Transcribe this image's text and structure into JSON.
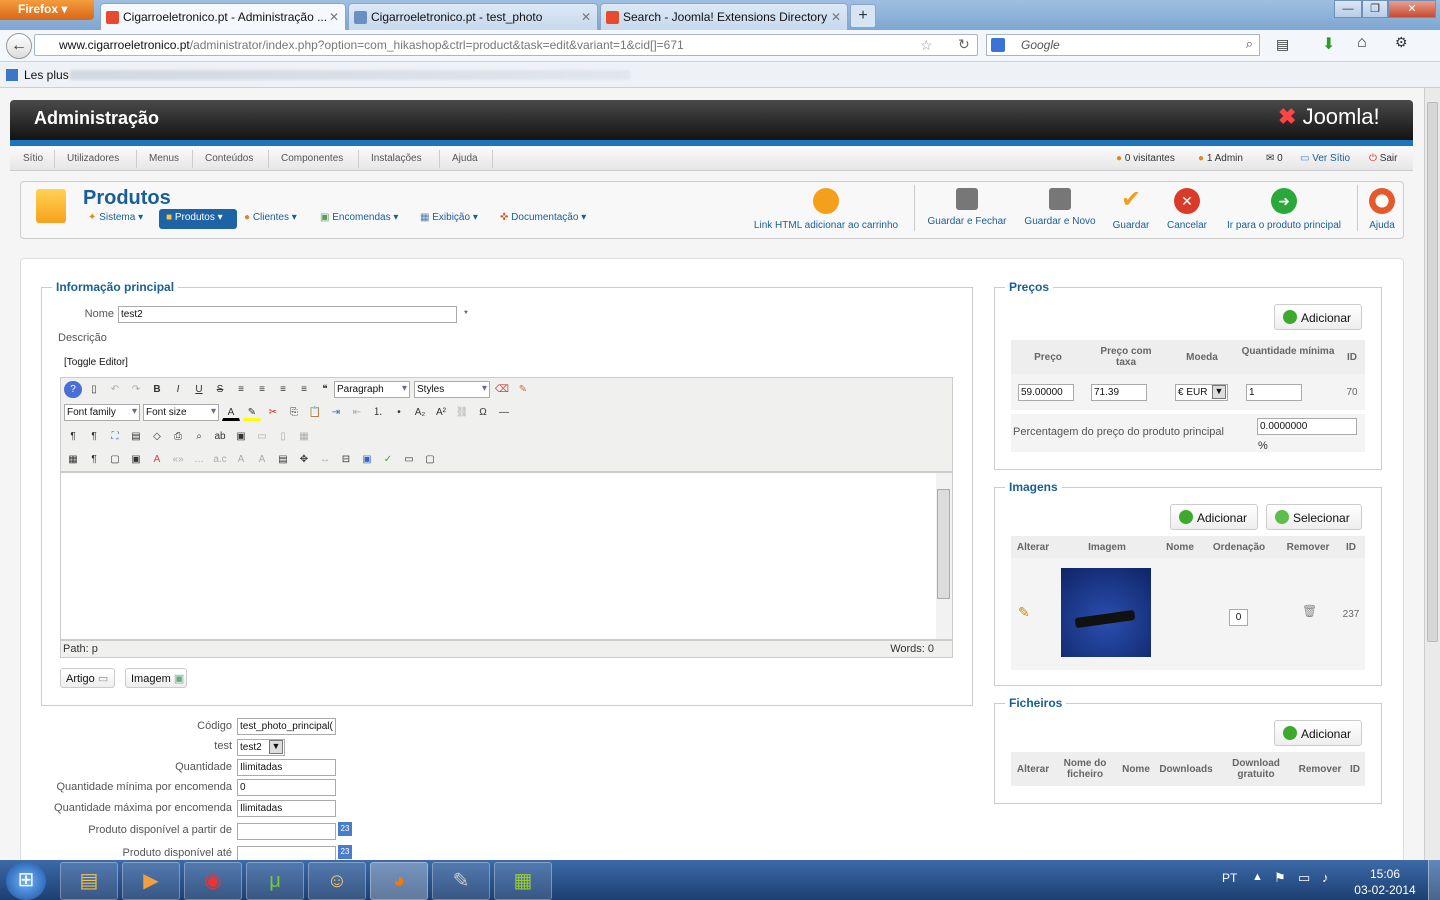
{
  "browser": {
    "menu_label": "Firefox",
    "tabs": [
      {
        "label": "Cigarroeletronico.pt - Administração ..."
      },
      {
        "label": "Cigarroeletronico.pt - test_photo"
      },
      {
        "label": "Search - Joomla! Extensions Directory"
      }
    ],
    "url_domain": "www.cigarroeletronico.pt",
    "url_path": "/administrator/index.php?option=com_hikashop&ctrl=product&task=edit&variant=1&cid[]=671",
    "search_placeholder": "Google",
    "bookmarks_label": "Les plus"
  },
  "joomla": {
    "header_title": "Administração",
    "logo_text": "Joomla!",
    "menu": [
      "Sítio",
      "Utilizadores",
      "Menus",
      "Conteúdos",
      "Componentes",
      "Instalações",
      "Ajuda"
    ],
    "status": {
      "visitors": "0 visitantes",
      "admin": "1 Admin",
      "messages": "0",
      "view_site": "Ver Sítio",
      "logout": "Sair"
    }
  },
  "component": {
    "title": "Produtos",
    "submenu": [
      "Sistema",
      "Produtos",
      "Clientes",
      "Encomendas",
      "Exibição",
      "Documentação"
    ],
    "toolbar": [
      "Link HTML adicionar ao carrinho",
      "Guardar e Fechar",
      "Guardar e Novo",
      "Guardar",
      "Cancelar",
      "Ir para o produto principal",
      "Ajuda"
    ]
  },
  "main_info": {
    "legend": "Informação principal",
    "name_label": "Nome",
    "name_value": "test2",
    "required_mark": "*",
    "description_label": "Descrição",
    "toggle_editor": "[Toggle Editor]",
    "editor": {
      "format_value": "Paragraph",
      "styles_value": "Styles",
      "font_family": "Font family",
      "font_size": "Font size",
      "path_label": "Path:",
      "path_value": "p",
      "words": "Words: 0"
    },
    "article_btn": "Artigo",
    "image_btn": "Imagem"
  },
  "fields": [
    {
      "label": "Código",
      "value": "test_photo_principal("
    },
    {
      "label": "test",
      "value": "test2"
    },
    {
      "label": "Quantidade",
      "value": "Ilimitadas"
    },
    {
      "label": "Quantidade mínima por encomenda",
      "value": "0"
    },
    {
      "label": "Quantidade máxima por encomenda",
      "value": "Ilimitadas"
    },
    {
      "label": "Produto disponível a partir de",
      "value": ""
    },
    {
      "label": "Produto disponível até",
      "value": ""
    }
  ],
  "prices": {
    "legend": "Preços",
    "add_btn": "Adicionar",
    "headers": [
      "Preço",
      "Preço com taxa",
      "Moeda",
      "Quantidade mínima",
      "ID"
    ],
    "row": {
      "price": "59.00000",
      "price_tax": "71.39",
      "currency": "€ EUR",
      "min_qty": "1",
      "id": "70"
    },
    "percent_label": "Percentagem do preço do produto principal",
    "percent_value": "0.0000000",
    "percent_sign": "%"
  },
  "images": {
    "legend": "Imagens",
    "add_btn": "Adicionar",
    "select_btn": "Selecionar",
    "headers": [
      "Alterar",
      "Imagem",
      "Nome",
      "Ordenação",
      "Remover",
      "ID"
    ],
    "row": {
      "order": "0",
      "id": "237"
    }
  },
  "files": {
    "legend": "Ficheiros",
    "add_btn": "Adicionar",
    "headers": [
      "Alterar",
      "Nome do ficheiro",
      "Nome",
      "Downloads",
      "Download gratuito",
      "Remover",
      "ID"
    ]
  },
  "taskbar": {
    "lang": "PT",
    "time": "15:06",
    "date": "03-02-2014"
  }
}
